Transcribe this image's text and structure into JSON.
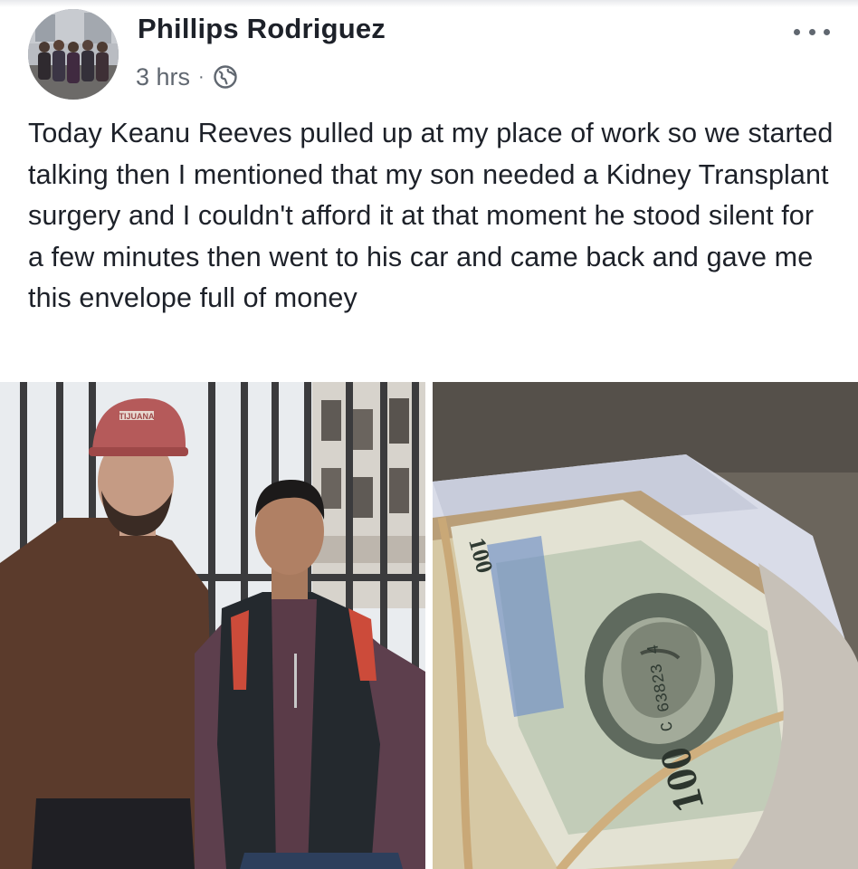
{
  "post": {
    "author": "Phillips Rodriguez",
    "timestamp": "3 hrs",
    "separator": "·",
    "privacy_icon": "globe-icon",
    "more_icon": "more-options-icon",
    "text": "Today Keanu Reeves pulled up at my place of work so we started talking then I mentioned that my son needed a Kidney Transplant surgery and I couldn't afford it at that moment he stood silent for a few minutes then went to his car and came back and gave me this envelope full of money"
  },
  "photos": {
    "left": {
      "cap_text": "TIJUANA"
    },
    "right": {
      "banknote_texts": [
        "100",
        "100",
        "C 63823 4"
      ]
    }
  },
  "colors": {
    "author_text": "#1d2129",
    "meta_text": "#606770",
    "background": "#ffffff"
  }
}
